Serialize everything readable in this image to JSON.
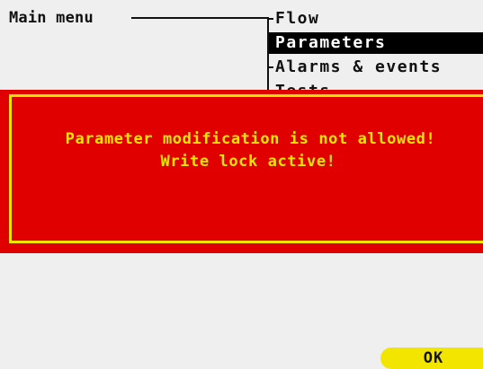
{
  "menu": {
    "title": "Main menu",
    "items": [
      {
        "label": "Flow",
        "selected": false
      },
      {
        "label": "Parameters",
        "selected": true
      },
      {
        "label": "Alarms & events",
        "selected": false
      },
      {
        "label": "Tests",
        "selected": false
      }
    ]
  },
  "alert": {
    "line1": "Parameter modification is not allowed!",
    "line2": "Write lock active!"
  },
  "softkeys": {
    "ok_label": "OK"
  },
  "colors": {
    "background": "#efefef",
    "alert_red": "#e00000",
    "alert_yellow": "#f2e600",
    "selection": "#000000"
  }
}
